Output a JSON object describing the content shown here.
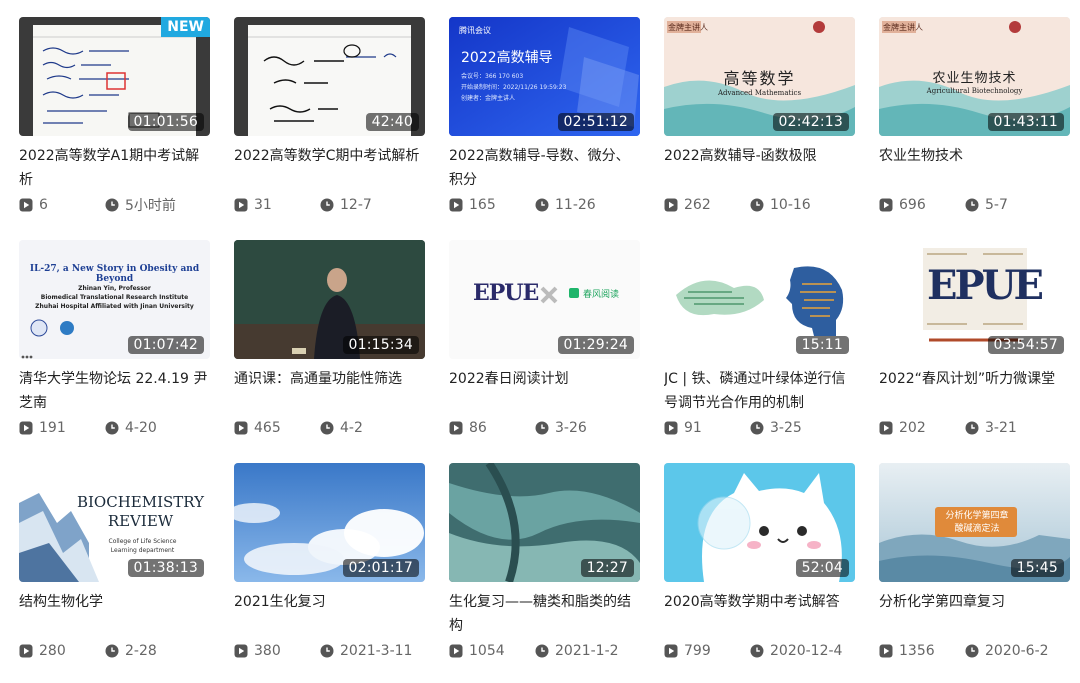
{
  "colors": {
    "badge_bg": "#21a9e0",
    "duration_bg": "rgba(0,0,0,0.55)",
    "meta_text": "#666666",
    "meta_icon": "#555555"
  },
  "videos": [
    {
      "title": "2022高等数学A1期中考试解析",
      "duration": "01:01:56",
      "plays": "6",
      "time": "5小时前",
      "badge": "NEW"
    },
    {
      "title": "2022高等数学C期中考试解析",
      "duration": "42:40",
      "plays": "31",
      "time": "12-7"
    },
    {
      "title": "2022高数辅导-导数、微分、积分",
      "duration": "02:51:12",
      "plays": "165",
      "time": "11-26",
      "thumb": {
        "brand": "腾讯会议",
        "heading": "2022高数辅导",
        "lines": [
          "会议号：366 170 603",
          "开始录制时间：2022/11/26 19:59:23",
          "创建者：金牌主讲人"
        ]
      }
    },
    {
      "title": "2022高数辅导-函数极限",
      "duration": "02:42:13",
      "plays": "262",
      "time": "10-16",
      "thumb": {
        "heading": "高等数学",
        "subheading": "Advanced Mathematics",
        "tag": "金牌主讲人"
      }
    },
    {
      "title": "农业生物技术",
      "duration": "01:43:11",
      "plays": "696",
      "time": "5-7",
      "thumb": {
        "heading": "农业生物技术",
        "subheading": "Agricultural Biotechnology",
        "tag": "金牌主讲人"
      }
    },
    {
      "title": "清华大学生物论坛 22.4.19 尹芝南",
      "duration": "01:07:42",
      "plays": "191",
      "time": "4-20",
      "thumb": {
        "heading": "IL-27, a New Story in Obesity and Beyond",
        "lines": [
          "Zhinan Yin, Professor",
          "Biomedical Translational Research Institute",
          "Zhuhai Hospital Affiliated with Jinan University"
        ]
      }
    },
    {
      "title": "通识课：高通量功能性筛选",
      "duration": "01:15:34",
      "plays": "465",
      "time": "4-2"
    },
    {
      "title": "2022春日阅读计划",
      "duration": "01:29:24",
      "plays": "86",
      "time": "3-26",
      "thumb": {
        "heading": "EPUE",
        "subheading": "春风阅读"
      }
    },
    {
      "title": "JC | 铁、磷通过叶绿体逆行信号调节光合作用的机制",
      "duration": "15:11",
      "plays": "91",
      "time": "3-25"
    },
    {
      "title": "2022“春风计划”听力微课堂",
      "duration": "03:54:57",
      "plays": "202",
      "time": "3-21",
      "thumb": {
        "heading": "EPUE"
      }
    },
    {
      "title": "结构生物化学",
      "duration": "01:38:13",
      "plays": "280",
      "time": "2-28",
      "thumb": {
        "heading_line1": "BIOCHEMISTRY",
        "heading_line2": "REVIEW",
        "lines": [
          "College of Life Science",
          "Learning department"
        ]
      }
    },
    {
      "title": "2021生化复习",
      "duration": "02:01:17",
      "plays": "380",
      "time": "2021-3-11"
    },
    {
      "title": "生化复习——糖类和脂类的结构",
      "duration": "12:27",
      "plays": "1054",
      "time": "2021-1-2"
    },
    {
      "title": "2020高等数学期中考试解答",
      "duration": "52:04",
      "plays": "799",
      "time": "2020-12-4"
    },
    {
      "title": "分析化学第四章复习",
      "duration": "15:45",
      "plays": "1356",
      "time": "2020-6-2",
      "thumb": {
        "heading": "分析化学第四章",
        "subheading": "酸碱滴定法"
      }
    }
  ]
}
